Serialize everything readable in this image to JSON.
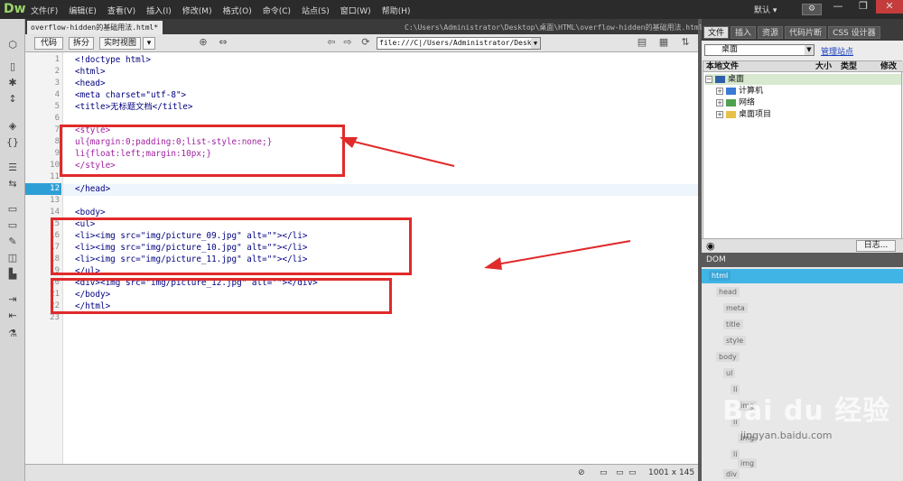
{
  "app": {
    "logo": "Dw"
  },
  "menu": [
    "文件(F)",
    "编辑(E)",
    "查看(V)",
    "插入(I)",
    "修改(M)",
    "格式(O)",
    "命令(C)",
    "站点(S)",
    "窗口(W)",
    "帮助(H)"
  ],
  "workspace": "默认 ▾",
  "window_buttons": [
    "—",
    "❐",
    "✕"
  ],
  "document": {
    "tab_title": "overflow-hidden的基础用法.html*",
    "path": "C:\\Users\\Administrator\\Desktop\\桌面\\HTML\\overflow-hidden的基础用法.html",
    "views": {
      "code": "代码",
      "split": "拆分",
      "live": "实时视图"
    },
    "address": "file:///C|/Users/Administrator/Desktop"
  },
  "code": {
    "line_numbers": [
      "1",
      "2",
      "3",
      "4",
      "5",
      "6",
      "7",
      "8",
      "9",
      "10",
      "11",
      "12",
      "13",
      "14",
      "15",
      "16",
      "17",
      "18",
      "19",
      "20",
      "21",
      "22",
      "23"
    ],
    "current_line": "12",
    "lines": [
      "<!doctype html>",
      "<html>",
      "<head>",
      "<meta charset=\"utf-8\">",
      "<title>无标题文档</title>",
      "",
      "<style>",
      "ul{margin:0;padding:0;list-style:none;}",
      "li{float:left;margin:10px;}",
      "</style>",
      "",
      "</head>",
      "",
      "<body>",
      "<ul>",
      "<li><img src=\"img/picture_09.jpg\" alt=\"\"></li>",
      "<li><img src=\"img/picture_10.jpg\" alt=\"\"></li>",
      "<li><img src=\"img/picture_11.jpg\" alt=\"\"></li>",
      "</ul>",
      "<div><img src=\"img/picture_12.jpg\" alt=\"\"></div>",
      "</body>",
      "</html>",
      ""
    ]
  },
  "status": {
    "size": "1001 x 145"
  },
  "panel": {
    "tabs": [
      "文件",
      "插入",
      "资源",
      "代码片断",
      "CSS 设计器"
    ],
    "site": "桌面",
    "manage": "管理站点",
    "columns": [
      "本地文件",
      "大小",
      "类型",
      "修改"
    ],
    "tree": [
      "桌面",
      "计算机",
      "网络",
      "桌面项目"
    ],
    "log": "日志...",
    "dom_title": "DOM",
    "dom_nodes": [
      "html",
      "head",
      "meta",
      "title",
      "style",
      "body",
      "ul",
      "li",
      "img",
      "li",
      "img",
      "li",
      "img",
      "div"
    ]
  },
  "watermark": {
    "brand": "Bai du 经验",
    "url": "jingyan.baidu.com"
  },
  "colors": {
    "accent": "#2e9fd6",
    "annotation": "#e12a2a",
    "tag": "#000080",
    "property": "#a020a0",
    "string": "#0000cc"
  }
}
